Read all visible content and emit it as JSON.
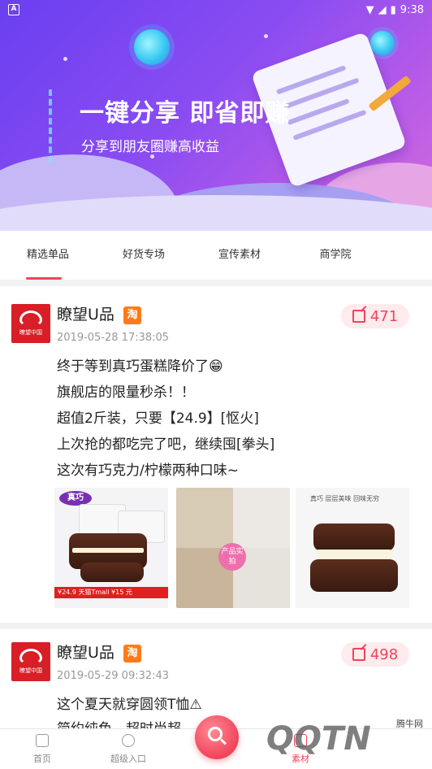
{
  "status_bar": {
    "time": "9:38"
  },
  "banner": {
    "title": "一键分享 即省即赚",
    "subtitle": "分享到朋友圈赚高收益"
  },
  "tabs": [
    {
      "label": "精选单品",
      "active": true
    },
    {
      "label": "好货专场",
      "active": false
    },
    {
      "label": "宣传素材",
      "active": false
    },
    {
      "label": "商学院",
      "active": false
    }
  ],
  "posts": [
    {
      "name": "瞭望U品",
      "badge": "淘",
      "time": "2019-05-28 17:38:05",
      "shares": "471",
      "lines": [
        "终于等到真巧蛋糕降价了😁",
        "旗舰店的限量秒杀！！",
        "超值2斤装，只要【24.9】[怄火]",
        "上次抢的都吃完了吧，继续囤[拳头]",
        "这次有巧克力/柠檬两种口味~"
      ],
      "images": {
        "p1_brand": "真巧",
        "p1_strip": "¥24.9  天猫Tmall   ¥15 元",
        "p2_badge": "产品实拍",
        "p3_text": "真巧  层层美味 回味无穷"
      }
    },
    {
      "name": "瞭望U品",
      "badge": "淘",
      "time": "2019-05-29 09:32:43",
      "shares": "498",
      "lines": [
        "这个夏天就穿圆领T恤⚠",
        "简约纯色，超时尚超"
      ]
    }
  ],
  "bottom_nav": {
    "home": "首页",
    "super": "超级入口",
    "mine": "素材"
  },
  "watermark": {
    "logo": "QQTN",
    "small": "腾牛网"
  },
  "colors": {
    "accent": "#f0445a",
    "tao": "#ff7a1a",
    "banner": "#7a46f0"
  }
}
